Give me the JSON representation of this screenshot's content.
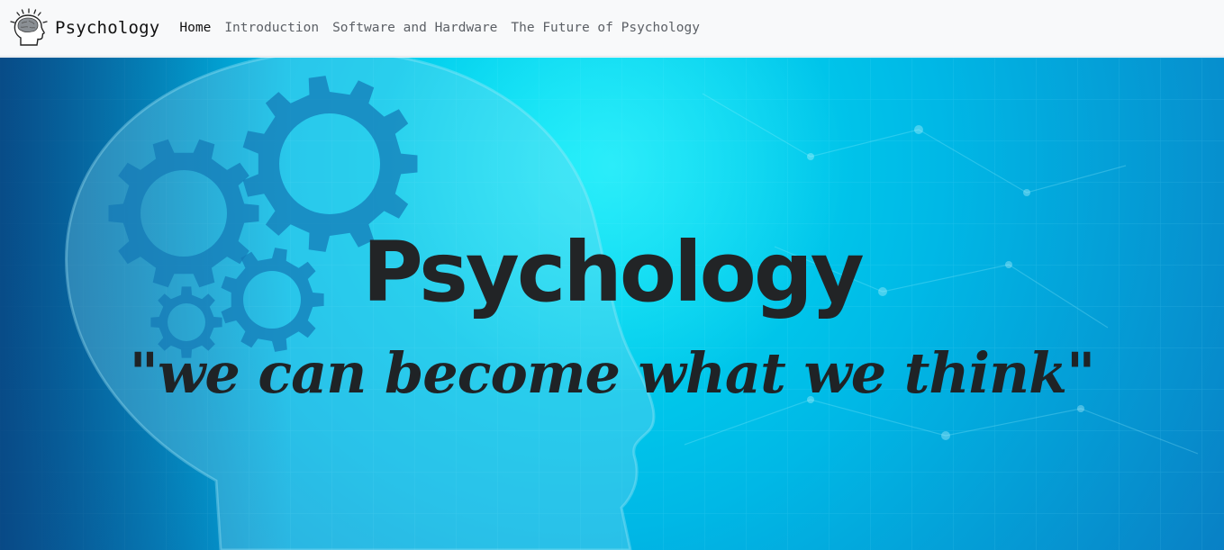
{
  "navbar": {
    "brand": {
      "name": "Psychology",
      "logo_icon": "head-gears-icon"
    },
    "links": [
      {
        "label": "Home",
        "active": true
      },
      {
        "label": "Introduction",
        "active": false
      },
      {
        "label": "Software and Hardware",
        "active": false
      },
      {
        "label": "The Future of Psychology",
        "active": false
      }
    ]
  },
  "hero": {
    "title": "Psychology",
    "quote": "\"we can become what we think\"",
    "background_icon": "head-with-gears-icon",
    "colors": {
      "background_light": "#00d8f0",
      "background_dark": "#0a5a9a",
      "text": "#222426"
    }
  }
}
